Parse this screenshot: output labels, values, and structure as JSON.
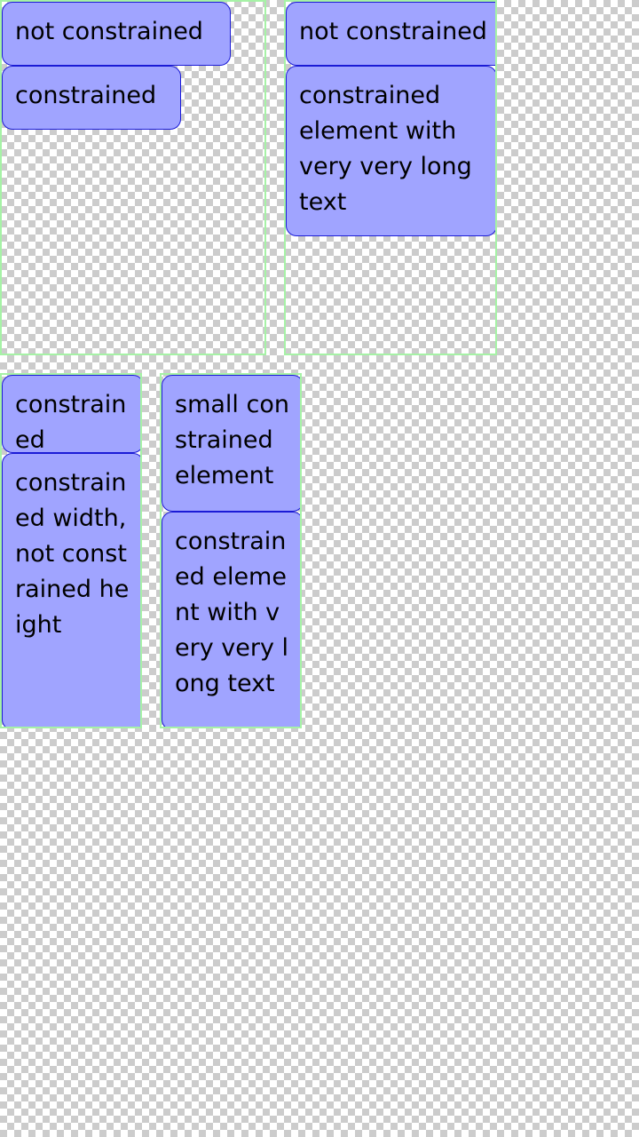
{
  "colors": {
    "box_fill": "#a0a4ff",
    "box_border": "#1b1bd6",
    "frame_border": "#a6f2a6"
  },
  "panels": [
    {
      "boxes": [
        {
          "text": "not constrained"
        },
        {
          "text": "constrained"
        }
      ]
    },
    {
      "boxes": [
        {
          "text": "not constrained"
        },
        {
          "text": "constrained element with very very long text"
        }
      ]
    },
    {
      "boxes": [
        {
          "text": "constrained"
        },
        {
          "text": "constrained width, not constrained height"
        }
      ]
    },
    {
      "boxes": [
        {
          "text": "small constrained element"
        },
        {
          "text": "constrained element with very very long text"
        }
      ]
    }
  ]
}
